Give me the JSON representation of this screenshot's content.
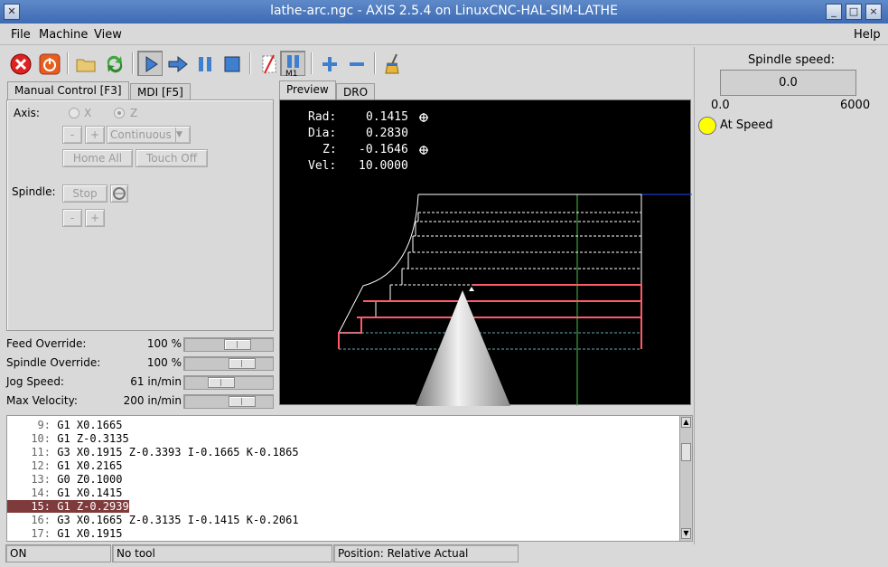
{
  "window": {
    "title": "lathe-arc.ngc - AXIS 2.5.4 on LinuxCNC-HAL-SIM-LATHE"
  },
  "menu": {
    "file": "File",
    "machine": "Machine",
    "view": "View",
    "help": "Help"
  },
  "tabs": {
    "manual": "Manual Control [F3]",
    "mdi": "MDI [F5]",
    "preview": "Preview",
    "dro": "DRO"
  },
  "manual": {
    "axis_label": "Axis:",
    "axis_x": "X",
    "axis_z": "Z",
    "minus": "-",
    "plus": "+",
    "jog_mode": "Continuous",
    "home_all": "Home All",
    "touch_off": "Touch Off",
    "spindle_label": "Spindle:",
    "stop": "Stop"
  },
  "overrides": [
    {
      "label": "Feed Override:",
      "value": "100 %",
      "level": 0.65
    },
    {
      "label": "Spindle Override:",
      "value": "100 %",
      "level": 0.72
    },
    {
      "label": "Jog Speed:",
      "value": "61 in/min",
      "level": 0.38
    },
    {
      "label": "Max Velocity:",
      "value": "200 in/min",
      "level": 0.72
    }
  ],
  "dro": {
    "rad_label": "Rad:",
    "rad": "0.1415",
    "dia_label": "Dia:",
    "dia": "0.2830",
    "z_label": "Z:",
    "z": "-0.1646",
    "vel_label": "Vel:",
    "vel": "10.0000"
  },
  "code": [
    {
      "n": "9:",
      "text": "G1 X0.1665"
    },
    {
      "n": "10:",
      "text": "G1 Z-0.3135"
    },
    {
      "n": "11:",
      "text": "G3 X0.1915 Z-0.3393 I-0.1665 K-0.1865"
    },
    {
      "n": "12:",
      "text": "G1 X0.2165"
    },
    {
      "n": "13:",
      "text": "G0 Z0.1000"
    },
    {
      "n": "14:",
      "text": "G1 X0.1415"
    },
    {
      "n": "15:",
      "text": "G1 Z-0.2939"
    },
    {
      "n": "16:",
      "text": "G3 X0.1665 Z-0.3135 I-0.1415 K-0.2061"
    },
    {
      "n": "17:",
      "text": "G1 X0.1915"
    }
  ],
  "status": {
    "state": "ON",
    "tool": "No tool",
    "position": "Position: Relative Actual"
  },
  "spindle": {
    "title": "Spindle speed:",
    "value": "0.0",
    "min": "0.0",
    "max": "6000",
    "at_speed": "At Speed"
  },
  "colors": {
    "title_bar": "#3d6bb3",
    "highlight": "#7f3b3b",
    "toolpath_feed": "#ff5a6a",
    "at_speed_led": "#ffff00"
  }
}
